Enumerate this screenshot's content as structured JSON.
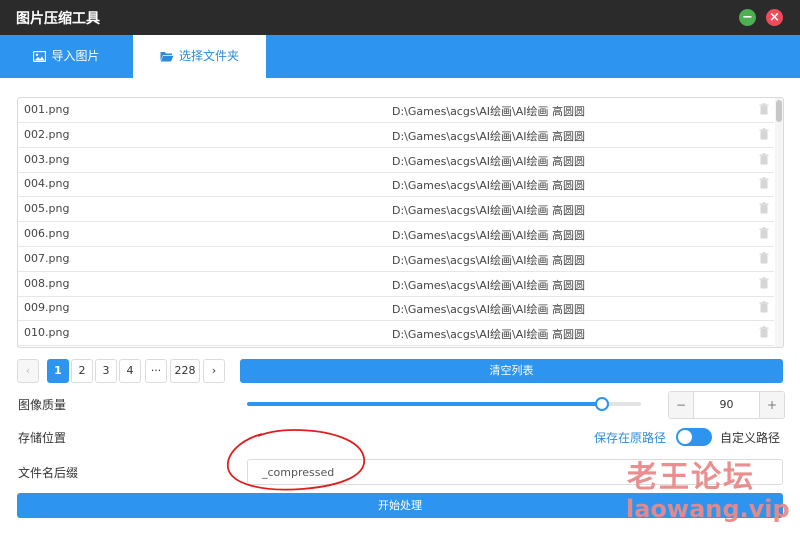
{
  "window": {
    "title": "图片压缩工具",
    "min_symbol": "−",
    "close_symbol": "×"
  },
  "tabs": [
    {
      "label": "导入图片",
      "icon": "image-icon",
      "active": false
    },
    {
      "label": "选择文件夹",
      "icon": "folder-open-icon",
      "active": true
    }
  ],
  "file_list": {
    "rows": [
      {
        "name": "001.png",
        "path": "D:\\Games\\acgs\\AI绘画\\AI绘画 高圆圆"
      },
      {
        "name": "002.png",
        "path": "D:\\Games\\acgs\\AI绘画\\AI绘画 高圆圆"
      },
      {
        "name": "003.png",
        "path": "D:\\Games\\acgs\\AI绘画\\AI绘画 高圆圆"
      },
      {
        "name": "004.png",
        "path": "D:\\Games\\acgs\\AI绘画\\AI绘画 高圆圆"
      },
      {
        "name": "005.png",
        "path": "D:\\Games\\acgs\\AI绘画\\AI绘画 高圆圆"
      },
      {
        "name": "006.png",
        "path": "D:\\Games\\acgs\\AI绘画\\AI绘画 高圆圆"
      },
      {
        "name": "007.png",
        "path": "D:\\Games\\acgs\\AI绘画\\AI绘画 高圆圆"
      },
      {
        "name": "008.png",
        "path": "D:\\Games\\acgs\\AI绘画\\AI绘画 高圆圆"
      },
      {
        "name": "009.png",
        "path": "D:\\Games\\acgs\\AI绘画\\AI绘画 高圆圆"
      },
      {
        "name": "010.png",
        "path": "D:\\Games\\acgs\\AI绘画\\AI绘画 高圆圆"
      }
    ],
    "row_action_icon": "trash-icon"
  },
  "pagination": {
    "prev": "‹",
    "pages": [
      "1",
      "2",
      "3",
      "4"
    ],
    "ellipsis": "···",
    "last": "228",
    "next": "›",
    "current": "1"
  },
  "clear_button": "清空列表",
  "quality": {
    "label": "图像质量",
    "value": "90",
    "fraction": 0.9,
    "minus": "−",
    "plus": "+"
  },
  "storage": {
    "label": "存储位置",
    "option_on": "保存在原路径",
    "option_off": "自定义路径",
    "toggle_state": "原路径"
  },
  "suffix": {
    "label": "文件名后缀",
    "value": "_compressed"
  },
  "start_button": "开始处理",
  "watermark": {
    "cn": "老王论坛",
    "en": "laowang.vip"
  },
  "colors": {
    "accent": "#2d95ef",
    "titlebar": "#2b2b2b",
    "annotation": "#e31c1c",
    "watermark": "#e88a8a"
  }
}
